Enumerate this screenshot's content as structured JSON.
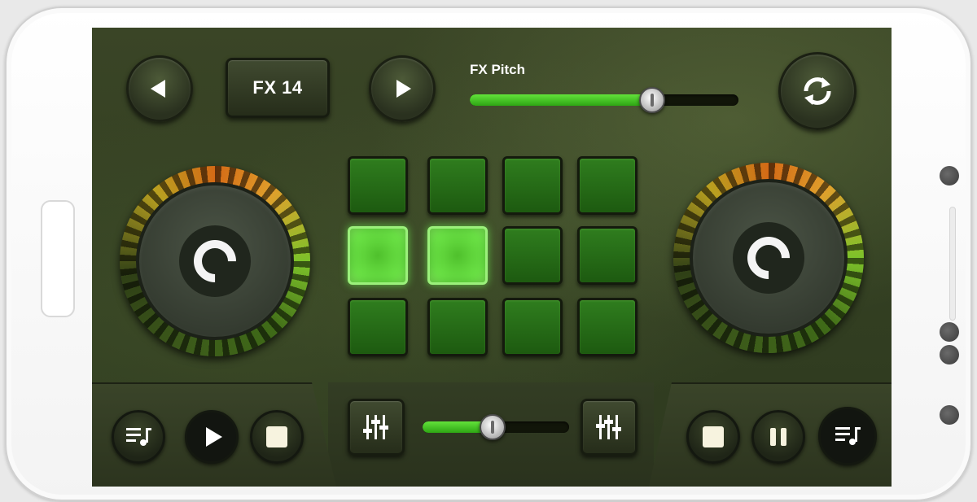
{
  "fx": {
    "prev_icon": "triangle-left-icon",
    "label": "FX 14",
    "next_icon": "triangle-right-icon",
    "sync_icon": "refresh-icon"
  },
  "pitch": {
    "label": "FX Pitch",
    "value_fraction": 0.68
  },
  "crossfader": {
    "value_fraction": 0.48
  },
  "pads": {
    "rows": 3,
    "cols": 4,
    "active": [
      4,
      5
    ]
  },
  "left_deck": {
    "controls": [
      "playlist-icon",
      "play-icon",
      "stop-icon"
    ]
  },
  "right_deck": {
    "controls": [
      "stop-icon",
      "pause-icon",
      "playlist-icon"
    ]
  },
  "colors": {
    "pad_idle": "#1d5a10",
    "pad_active": "#6ee648",
    "slider_fill": "#3fc022"
  }
}
